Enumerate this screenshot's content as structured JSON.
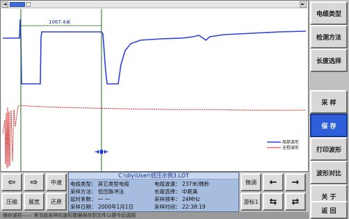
{
  "scrollbar": {
    "left_arrow": "◄",
    "right_arrow": "►"
  },
  "plot": {
    "cursor_distance_label": "1067.4米",
    "legend": [
      {
        "label": "局部波形",
        "color": "#2a3ed8"
      },
      {
        "label": "全程波形",
        "color": "#d82020"
      }
    ]
  },
  "right_menu": [
    {
      "label": "电缆类型",
      "active": false
    },
    {
      "label": "检测方法",
      "active": false
    },
    {
      "label": "长度选择",
      "active": false
    },
    {
      "label": "采  样",
      "active": false
    },
    {
      "label": "保  存",
      "active": true
    },
    {
      "label": "打印波形",
      "active": false
    },
    {
      "label": "波形对比",
      "active": false
    },
    {
      "label": "关  于",
      "active": false
    },
    {
      "label": "返  回",
      "active": false
    }
  ],
  "controls": {
    "left_arrow_icon": "⇦",
    "right_arrow_icon": "⇨",
    "zoom_center": "中速",
    "compress": "压缩",
    "expand": "展宽",
    "restore": "还原",
    "fine_tune": "微调",
    "cursor_toggle": "游标1",
    "arrow_left": "←",
    "arrow_right": "→",
    "arrow_move_left": "⇆",
    "arrow_move_right": "⇄"
  },
  "info": {
    "file_path": "C:\\dly\\User\\低压示例3.LDT",
    "rows": [
      [
        "电缆类型：  其它类型电缆",
        "电缆波速：  237米/微秒"
      ],
      [
        "采样方法：  低压脉冲法",
        "长度选择：  中距离"
      ],
      [
        "延时系数：  一 一",
        "采样频率：  24MHz"
      ],
      [
        "采样日期：  2000年1月1日",
        "采样时间：  22:38:19"
      ]
    ]
  },
  "status": {
    "text": "保存波形——  将当前采样的波形数据保存到文件以便今后调用"
  },
  "colors": {
    "local_waveform": "#2a3ed8",
    "full_waveform": "#d82020",
    "cursor_line": "#1a6a1a",
    "active_button": "#2f5fd8"
  }
}
